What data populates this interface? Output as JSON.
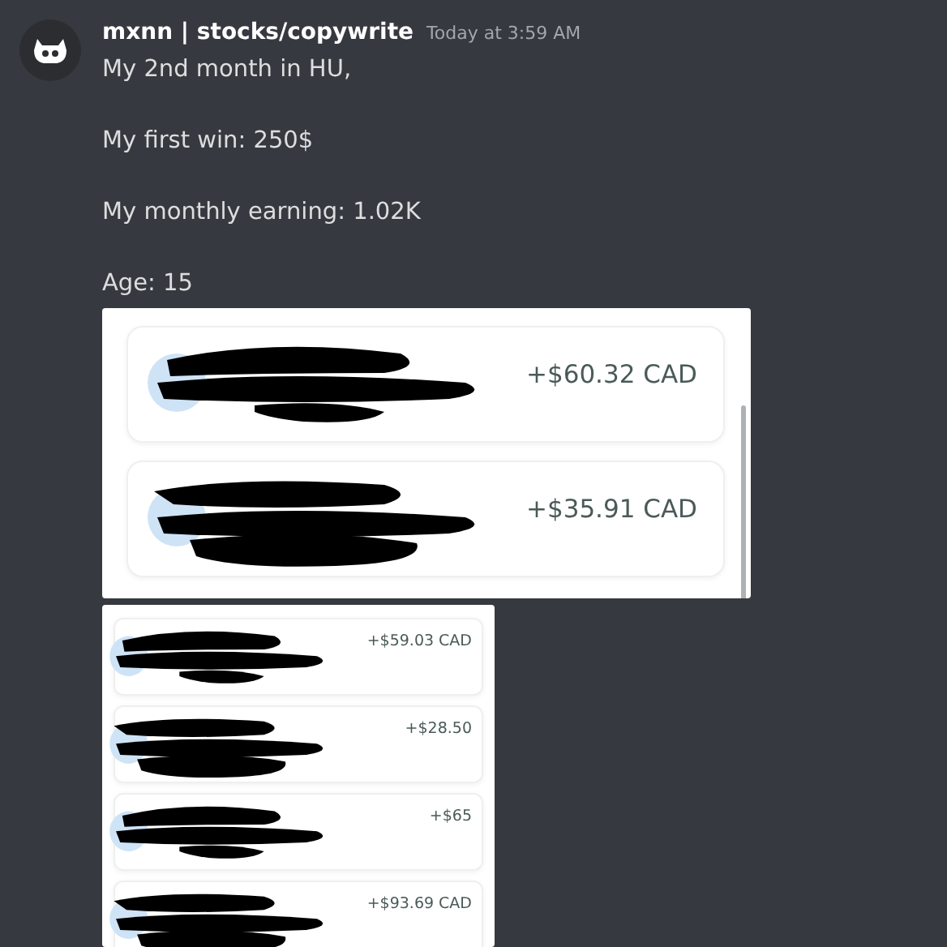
{
  "message": {
    "author": "mxnn | stocks/copywrite",
    "timestamp": "Today at 3:59 AM",
    "lines": [
      "My 2nd month in HU,",
      "My first win: 250$",
      "My monthly earning: 1.02K",
      "Age: 15"
    ]
  },
  "attachments": [
    {
      "kind": "large",
      "transactions": [
        {
          "amount": "+$60.32 CAD"
        },
        {
          "amount": "+$35.91 CAD"
        }
      ]
    },
    {
      "kind": "small",
      "transactions": [
        {
          "amount": "+$59.03 CAD"
        },
        {
          "amount": "+$28.50"
        },
        {
          "amount": "+$65"
        },
        {
          "amount": "+$93.69 CAD"
        }
      ]
    }
  ]
}
